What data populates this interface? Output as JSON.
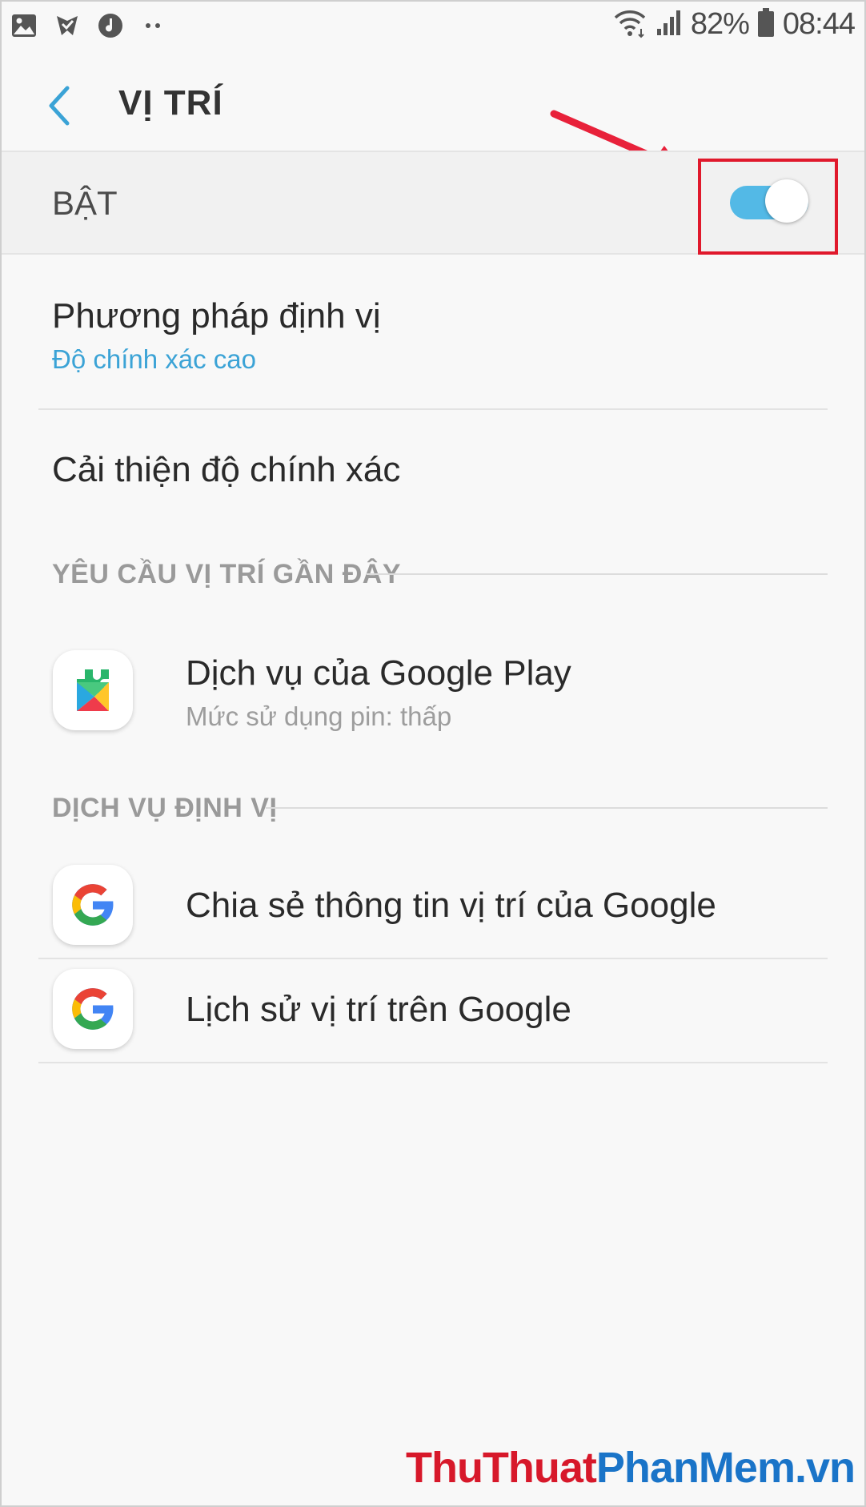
{
  "status_bar": {
    "left_icons": [
      "gallery-icon",
      "checkmark-badge-icon",
      "music-note-icon",
      "more-dots-icon"
    ],
    "battery_percent": "82%",
    "time": "08:44"
  },
  "header": {
    "title": "VỊ TRÍ"
  },
  "master_switch": {
    "label": "BẬT",
    "state": "on",
    "track_color": "#53b9e6"
  },
  "settings": {
    "locating_method": {
      "title": "Phương pháp định vị",
      "value": "Độ chính xác cao",
      "value_color": "#3ba3d6"
    },
    "improve_accuracy": {
      "title": "Cải thiện độ chính xác"
    }
  },
  "recent_requests": {
    "header": "YÊU CẦU VỊ TRÍ GẦN ĐÂY",
    "items": [
      {
        "title": "Dịch vụ của Google Play",
        "subtitle": "Mức sử dụng pin: thấp",
        "icon": "google-play-services-icon"
      }
    ]
  },
  "location_services": {
    "header": "DỊCH VỤ ĐỊNH VỊ",
    "items": [
      {
        "title": "Chia sẻ thông tin vị trí của Google",
        "icon": "google-g-icon"
      },
      {
        "title": "Lịch sử vị trí trên Google",
        "icon": "google-g-icon"
      }
    ]
  },
  "watermark": {
    "part1": "ThuThuat",
    "part2": "PhanMem",
    "part3": ".vn",
    "color_red": "#d7182a",
    "color_blue": "#1a74c8"
  }
}
